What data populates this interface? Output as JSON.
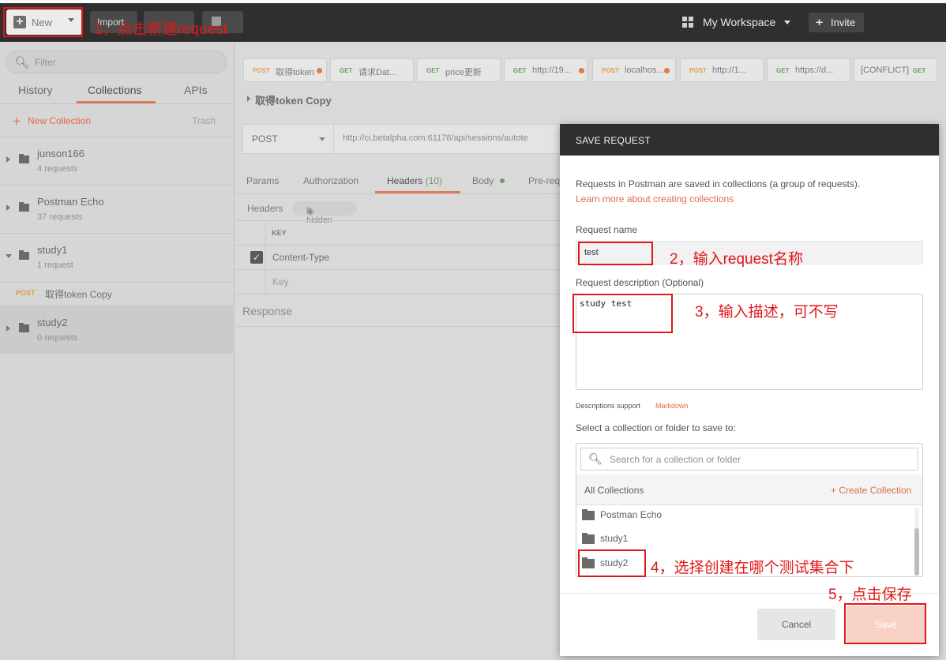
{
  "topbar": {
    "new_label": "New",
    "import_label": "Import",
    "workspace_label": "My Workspace",
    "invite_label": "Invite"
  },
  "sidebar": {
    "filter_placeholder": "Filter",
    "tabs": [
      "History",
      "Collections",
      "APIs"
    ],
    "new_collection": "New Collection",
    "trash": "Trash",
    "collections": [
      {
        "name": "junson166",
        "count": "4 requests"
      },
      {
        "name": "Postman Echo",
        "count": "37 requests"
      },
      {
        "name": "study1",
        "count": "1 request"
      },
      {
        "name": "study2",
        "count": "0 requests"
      }
    ],
    "study1_request": {
      "method": "POST",
      "name": "取得token Copy"
    }
  },
  "request_tabs": [
    {
      "method": "POST",
      "title": "取得token",
      "dot": true
    },
    {
      "method": "GET",
      "title": "请求Dat...",
      "dot": false
    },
    {
      "method": "GET",
      "title": "price更新",
      "dot": false
    },
    {
      "method": "GET",
      "title": "http://19...",
      "dot": true
    },
    {
      "method": "POST",
      "title": "localhos...",
      "dot": true
    },
    {
      "method": "POST",
      "title": "http://1...",
      "dot": false
    },
    {
      "method": "GET",
      "title": "https://d...",
      "dot": false
    },
    {
      "method": "GET",
      "title": "[CONFLICT]",
      "dot": false
    }
  ],
  "request": {
    "breadcrumb": "取得token Copy",
    "method": "POST",
    "url": "http://ci.betalpha.com:61178/api/sessions/autote",
    "tabs": {
      "params": "Params",
      "authorization": "Authorization",
      "headers": "Headers",
      "headers_count": "(10)",
      "body": "Body",
      "pre_request": "Pre-req"
    },
    "headers_label": "Headers",
    "hidden_count": "9 hidden",
    "table_key_header": "KEY",
    "header_row_key": "Content-Type",
    "key_placeholder": "Key",
    "response_label": "Response"
  },
  "dialog": {
    "title": "SAVE REQUEST",
    "description": "Requests in Postman are saved in collections (a group of requests).",
    "learn_more": "Learn more about creating collections",
    "name_label": "Request name",
    "name_value": "test",
    "desc_label": "Request description (Optional)",
    "desc_value": "study test",
    "desc_support": "Descriptions support",
    "markdown": "Markdown",
    "select_label": "Select a collection or folder to save to:",
    "search_placeholder": "Search for a collection or folder",
    "all_collections": "All Collections",
    "create_collection": "+ Create Collection",
    "picker_items": [
      "Postman Echo",
      "study1",
      "study2"
    ],
    "cancel": "Cancel",
    "save": "Save"
  },
  "annotations": {
    "a1": "1，点击新建request",
    "a2": "2，输入request名称",
    "a3": "3，输入描述，可不写",
    "a4": "4，选择创建在哪个测试集合下",
    "a5": "5，点击保存"
  },
  "colors": {
    "accent": "#e06a4a",
    "annotation_red": "#e01818",
    "topbar": "#2f2f2f",
    "post": "#e0a050",
    "get": "#6aa060"
  }
}
